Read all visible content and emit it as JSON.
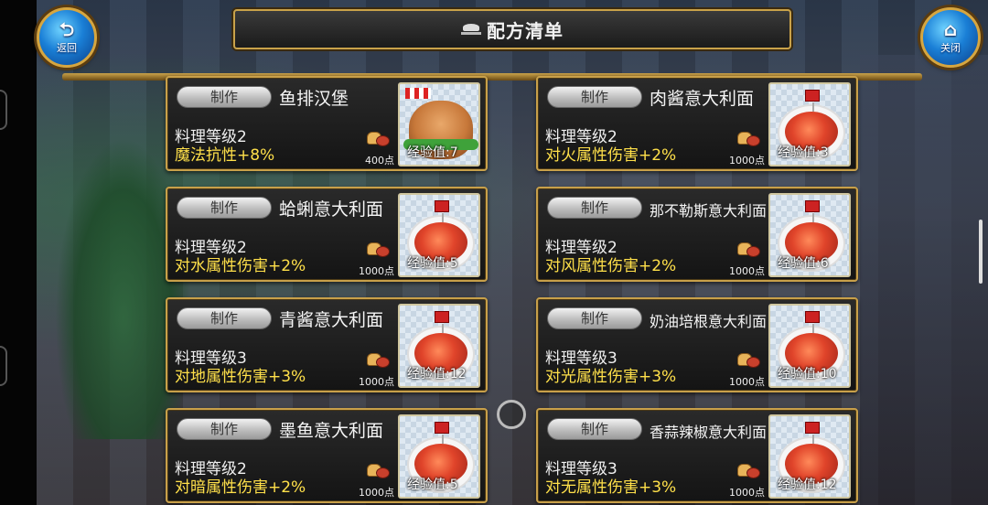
{
  "header": {
    "title": "配方清单",
    "back_label": "返回",
    "close_label": "关闭"
  },
  "card_common": {
    "make_label": "制作"
  },
  "recipes": [
    {
      "name": "鱼排汉堡",
      "level": "料理等级2",
      "effect": "魔法抗性+8%",
      "cost": "400点",
      "exp": "经验值:7",
      "image": "burger"
    },
    {
      "name": "肉酱意大利面",
      "level": "料理等级2",
      "effect": "对火属性伤害+2%",
      "cost": "1000点",
      "exp": "经验值:3",
      "image": "pasta"
    },
    {
      "name": "蛤蜊意大利面",
      "level": "料理等级2",
      "effect": "对水属性伤害+2%",
      "cost": "1000点",
      "exp": "经验值:5",
      "image": "pasta"
    },
    {
      "name": "那不勒斯意大利面",
      "level": "料理等级2",
      "effect": "对风属性伤害+2%",
      "cost": "1000点",
      "exp": "经验值:6",
      "image": "pasta"
    },
    {
      "name": "青酱意大利面",
      "level": "料理等级3",
      "effect": "对地属性伤害+3%",
      "cost": "1000点",
      "exp": "经验值:12",
      "image": "pasta"
    },
    {
      "name": "奶油培根意大利面",
      "level": "料理等级3",
      "effect": "对光属性伤害+3%",
      "cost": "1000点",
      "exp": "经验值:10",
      "image": "pasta"
    },
    {
      "name": "墨鱼意大利面",
      "level": "料理等级2",
      "effect": "对暗属性伤害+2%",
      "cost": "1000点",
      "exp": "经验值:5",
      "image": "pasta"
    },
    {
      "name": "香蒜辣椒意大利面",
      "level": "料理等级3",
      "effect": "对无属性伤害+3%",
      "cost": "1000点",
      "exp": "经验值:12",
      "image": "pasta"
    }
  ],
  "colors": {
    "card_border": "#c8a04a",
    "effect_text": "#ffe04a",
    "button_blue": "#1a7fd6"
  }
}
